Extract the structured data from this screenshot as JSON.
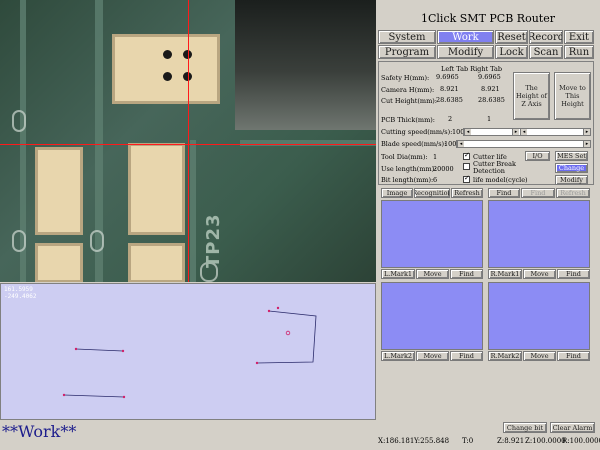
{
  "app": {
    "title": "1Click SMT PCB Router"
  },
  "menu": {
    "row1": [
      "System",
      "Work",
      "Reset",
      "Record",
      "Exit"
    ],
    "row2": [
      "Program",
      "Modify",
      "Lock",
      "Scan",
      "Run"
    ],
    "active": "Work"
  },
  "camera": {
    "silkscreen": "TP23",
    "pathview_readout": [
      "161.5959",
      "-249.4062"
    ]
  },
  "params": {
    "tab_header": "Left Tab Right Tab",
    "safety_label": "Safety H(mm):",
    "safety_left": "9.6965",
    "safety_right": "9.6965",
    "camera_label": "Camera H(mm):",
    "camera_left": "8.921",
    "camera_right": "8.921",
    "cut_label": "Cut Height(mm):",
    "cut_left": "28.6385",
    "cut_right": "28.6385",
    "height_z_btn": "The Height of Z Axis",
    "move_height_btn": "Move to This Height",
    "pcb_thick_label": "PCB Thick(mm):",
    "pcb_thick_left": "2",
    "pcb_thick_right": "1",
    "cutting_speed_label": "Cutting speed(mm/s):",
    "cutting_speed_value": "100",
    "blade_speed_label": "Blade speed(mm/s):",
    "blade_speed_value": "100",
    "tool_dia_label": "Tool Dia(mm):",
    "tool_dia_value": "1",
    "cutter_life_label": "Cutter life",
    "io_btn": "I/O",
    "mes_set_btn": "MES Set",
    "use_length_label": "Use length(mm):",
    "use_length_value": "20000",
    "cutter_break_label": "Cutter Break Detection",
    "change_btn": "Change",
    "bit_length_label": "Bit length(mm):",
    "bit_length_value": "6",
    "life_model_label": "life model(cycle)",
    "modify_btn": "Modify"
  },
  "vision": {
    "top_left": [
      "Image",
      "Recognition",
      "Refresh"
    ],
    "top_right": [
      "Find",
      "Find",
      "Refresh"
    ],
    "row1_left": [
      "L.Mark1",
      "Move",
      "Find"
    ],
    "row1_right": [
      "R.Mark1",
      "Move",
      "Find"
    ],
    "row2_left": [
      "L.Mark2",
      "Move",
      "Find"
    ],
    "row2_right": [
      "R.Mark2",
      "Move",
      "Find"
    ]
  },
  "status": {
    "mode": "**Work**",
    "change_bit": "Change bit",
    "clear_alarm": "Clear Alarm",
    "x": "X:186.181",
    "y": "Y:255.848",
    "t": "T:0",
    "z": "Z:8.921",
    "z1": "Z:100.0000",
    "r": "R:100.0000"
  },
  "colors": {
    "accent": "#8080f0",
    "mark_area": "#8c8cf4",
    "path_bg": "#cdcdf2",
    "crosshair": "#ff1a1a"
  }
}
